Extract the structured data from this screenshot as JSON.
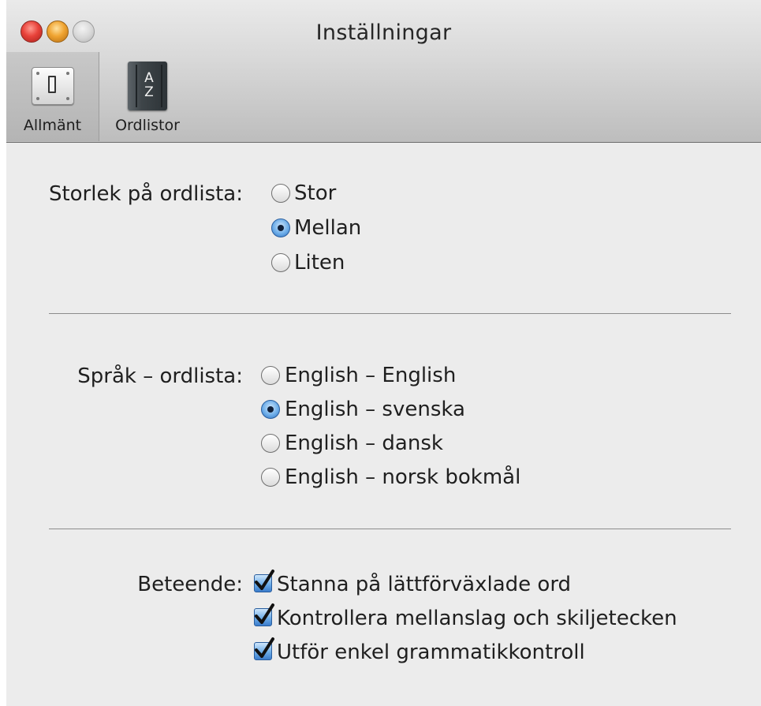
{
  "window": {
    "title": "Inställningar"
  },
  "toolbar": {
    "general_label": "Allmänt",
    "dictionaries_label": "Ordlistor",
    "dict_icon_letters": [
      "A",
      "Z"
    ]
  },
  "size": {
    "label": "Storlek på ordlista:",
    "options": [
      "Stor",
      "Mellan",
      "Liten"
    ],
    "selected": "Mellan"
  },
  "language": {
    "label": "Språk – ordlista:",
    "options": [
      "English – English",
      "English – svenska",
      "English – dansk",
      "English – norsk bokmål"
    ],
    "selected": "English – svenska"
  },
  "behavior": {
    "label": "Beteende:",
    "options": [
      {
        "label": "Stanna på lättförväxlade ord",
        "checked": true
      },
      {
        "label": "Kontrollera mellanslag och skiljetecken",
        "checked": true
      },
      {
        "label": "Utför enkel grammatikkontroll",
        "checked": true
      }
    ]
  },
  "colors": {
    "accent": "#3b7ccb",
    "close": "#e8423a",
    "minimize": "#f0a431"
  }
}
